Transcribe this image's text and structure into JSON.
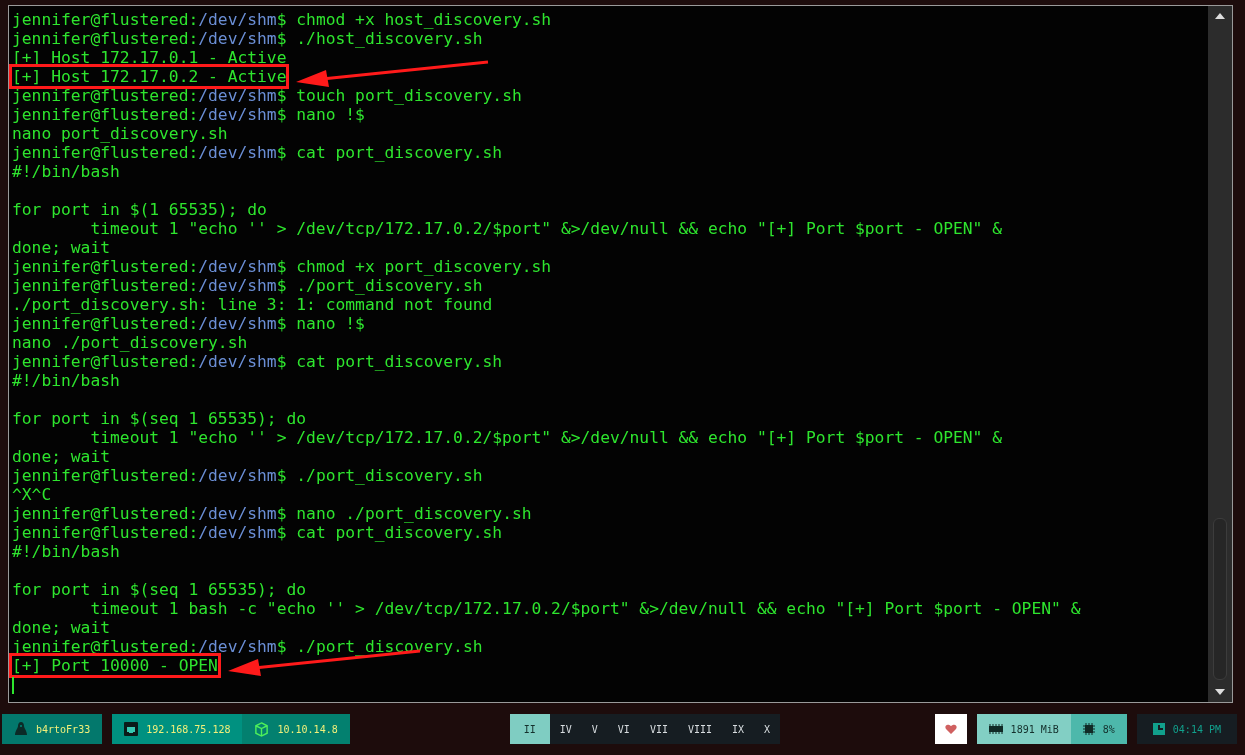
{
  "terminal": {
    "lines": [
      {
        "kind": "prompt",
        "host": "jennifer@flustered:",
        "path": "/dev/shm",
        "end": "$",
        "command": "chmod +x host_discovery.sh"
      },
      {
        "kind": "prompt",
        "host": "jennifer@flustered:",
        "path": "/dev/shm",
        "end": "$",
        "command": "./host_discovery.sh"
      },
      {
        "kind": "output",
        "text": "[+] Host 172.17.0.1 - Active",
        "highlight": false
      },
      {
        "kind": "output",
        "text": "[+] Host 172.17.0.2 - Active",
        "highlight": true
      },
      {
        "kind": "prompt",
        "host": "jennifer@flustered:",
        "path": "/dev/shm",
        "end": "$",
        "command": "touch port_discovery.sh"
      },
      {
        "kind": "prompt",
        "host": "jennifer@flustered:",
        "path": "/dev/shm",
        "end": "$",
        "command": "nano !$"
      },
      {
        "kind": "output",
        "text": "nano port_discovery.sh",
        "highlight": false
      },
      {
        "kind": "prompt",
        "host": "jennifer@flustered:",
        "path": "/dev/shm",
        "end": "$",
        "command": "cat port_discovery.sh"
      },
      {
        "kind": "output",
        "text": "#!/bin/bash",
        "highlight": false
      },
      {
        "kind": "blank"
      },
      {
        "kind": "output",
        "text": "for port in $(1 65535); do",
        "highlight": false
      },
      {
        "kind": "output",
        "text": "        timeout 1 \"echo '' > /dev/tcp/172.17.0.2/$port\" &>/dev/null && echo \"[+] Port $port - OPEN\" &",
        "highlight": false
      },
      {
        "kind": "output",
        "text": "done; wait",
        "highlight": false
      },
      {
        "kind": "prompt",
        "host": "jennifer@flustered:",
        "path": "/dev/shm",
        "end": "$",
        "command": "chmod +x port_discovery.sh"
      },
      {
        "kind": "prompt",
        "host": "jennifer@flustered:",
        "path": "/dev/shm",
        "end": "$",
        "command": "./port_discovery.sh"
      },
      {
        "kind": "output",
        "text": "./port_discovery.sh: line 3: 1: command not found",
        "highlight": false
      },
      {
        "kind": "prompt",
        "host": "jennifer@flustered:",
        "path": "/dev/shm",
        "end": "$",
        "command": "nano !$"
      },
      {
        "kind": "output",
        "text": "nano ./port_discovery.sh",
        "highlight": false
      },
      {
        "kind": "prompt",
        "host": "jennifer@flustered:",
        "path": "/dev/shm",
        "end": "$",
        "command": "cat port_discovery.sh"
      },
      {
        "kind": "output",
        "text": "#!/bin/bash",
        "highlight": false
      },
      {
        "kind": "blank"
      },
      {
        "kind": "output",
        "text": "for port in $(seq 1 65535); do",
        "highlight": false
      },
      {
        "kind": "output",
        "text": "        timeout 1 \"echo '' > /dev/tcp/172.17.0.2/$port\" &>/dev/null && echo \"[+] Port $port - OPEN\" &",
        "highlight": false
      },
      {
        "kind": "output",
        "text": "done; wait",
        "highlight": false
      },
      {
        "kind": "prompt",
        "host": "jennifer@flustered:",
        "path": "/dev/shm",
        "end": "$",
        "command": "./port_discovery.sh"
      },
      {
        "kind": "output",
        "text": "^X^C",
        "highlight": false
      },
      {
        "kind": "prompt",
        "host": "jennifer@flustered:",
        "path": "/dev/shm",
        "end": "$",
        "command": "nano ./port_discovery.sh"
      },
      {
        "kind": "prompt",
        "host": "jennifer@flustered:",
        "path": "/dev/shm",
        "end": "$",
        "command": "cat port_discovery.sh"
      },
      {
        "kind": "output",
        "text": "#!/bin/bash",
        "highlight": false
      },
      {
        "kind": "blank"
      },
      {
        "kind": "output",
        "text": "for port in $(seq 1 65535); do",
        "highlight": false
      },
      {
        "kind": "output",
        "text": "        timeout 1 bash -c \"echo '' > /dev/tcp/172.17.0.2/$port\" &>/dev/null && echo \"[+] Port $port - OPEN\" &",
        "highlight": false
      },
      {
        "kind": "output",
        "text": "done; wait",
        "highlight": false
      },
      {
        "kind": "prompt",
        "host": "jennifer@flustered:",
        "path": "/dev/shm",
        "end": "$",
        "command": "./port_discovery.sh"
      },
      {
        "kind": "output",
        "text": "[+] Port 10000 - OPEN",
        "highlight": true
      },
      {
        "kind": "cursor"
      }
    ]
  },
  "panel": {
    "user": "b4rtoFr33",
    "addresses": [
      {
        "kind": "lan",
        "text": "192.168.75.128"
      },
      {
        "kind": "vpn",
        "text": "10.10.14.8"
      }
    ],
    "workspaces": [
      {
        "label": "II",
        "selected": true
      },
      {
        "label": "IV",
        "selected": false
      },
      {
        "label": "V",
        "selected": false
      },
      {
        "label": "VI",
        "selected": false
      },
      {
        "label": "VII",
        "selected": false
      },
      {
        "label": "VIII",
        "selected": false
      },
      {
        "label": "IX",
        "selected": false
      },
      {
        "label": "X",
        "selected": false
      }
    ],
    "memory": "1891 MiB",
    "cpu": "8%",
    "clock": "04:14 PM"
  }
}
